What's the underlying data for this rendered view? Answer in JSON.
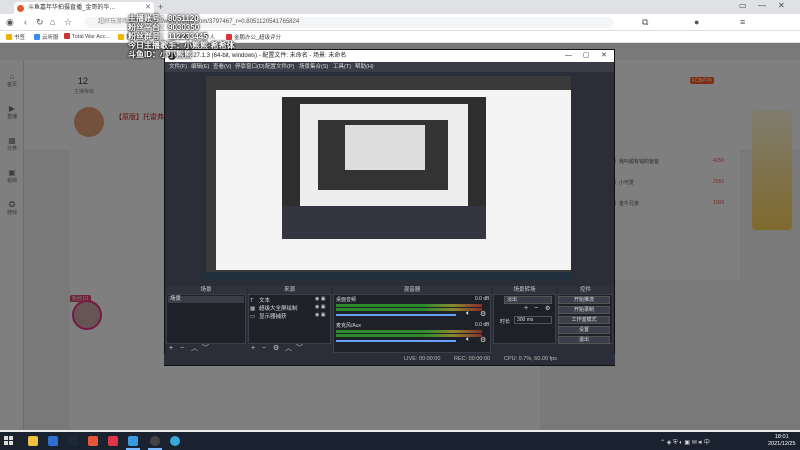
{
  "browser": {
    "tab_title": "斗鱼嘉年华拍摄直播_金哥的华…",
    "address_prefix": "超好玩游戏推荐",
    "address_url": "https://www.douyu.com/3797467_r=0.805112054176582​4",
    "bookmarks": [
      "书签",
      "云听服",
      "Total War Acc…",
      "我的门户",
      "上传...",
      "下载",
      "个人",
      "金鹏办公_超级评分"
    ]
  },
  "overlay": {
    "line1": "主播账号：8051120",
    "line2": "粉丝平台：9030350",
    "line3": "粉丝群号：112233445",
    "line4": "今日主播歌手：小熊熊·希希体",
    "line5": "斗鱼ID：小小熊熊"
  },
  "page": {
    "stream_title": "【原版】托雷弗…",
    "left_nav": [
      {
        "icon": "home-icon",
        "label": "首页"
      },
      {
        "icon": "live-icon",
        "label": "直播"
      },
      {
        "icon": "category-icon",
        "label": "分类"
      },
      {
        "icon": "video-icon",
        "label": "视频"
      },
      {
        "icon": "game-icon",
        "label": "游戏"
      }
    ],
    "stats": {
      "value": "12",
      "label": "主播等级"
    },
    "rank_items": [
      {
        "name": "我叫超有钱的爸爸",
        "score": "4250"
      },
      {
        "name": "小可爱",
        "score": "2050"
      },
      {
        "name": "金牛兄弟",
        "score": "1000"
      }
    ],
    "fcb_label": "FCB户外",
    "gift_tag": "粉丝1/1",
    "gift_count": "0/1"
  },
  "obs": {
    "window_title": "OBS 27.1.3 (64-bit, windows) - 配置文件: 未命名 - 场景: 未命名",
    "menu": [
      "文件(F)",
      "编辑(E)",
      "查看(V)",
      "停靠窗口(D)",
      "配置文件(P)",
      "场景集合(S)",
      "工具(T)",
      "帮助(H)"
    ],
    "docks": {
      "scenes": "场景",
      "sources": "来源",
      "mixer": "混音器",
      "transitions": "场景转场",
      "controls": "控件"
    },
    "scene_items": [
      "场景"
    ],
    "source_items": [
      {
        "icon": "T",
        "label": "文本"
      },
      {
        "icon": "▦",
        "label": "超级大全屏绘制"
      },
      {
        "icon": "▭",
        "label": "显示器捕获"
      }
    ],
    "mixer_channels": [
      {
        "label": "桌面音频",
        "db": "0.0 dB"
      },
      {
        "label": "麦克风/Aux",
        "db": "0.0 dB"
      }
    ],
    "transition": {
      "type": "淡出",
      "duration_label": "时长",
      "duration": "300 ms"
    },
    "controls": [
      "开始推流",
      "开始录制",
      "工作室模式",
      "设置",
      "退出"
    ],
    "status": {
      "live": "LIVE: 00:00:00",
      "rec": "REC: 00:00:00",
      "cpu": "CPU: 0.7%, 60.00 fps"
    }
  },
  "taskbar": {
    "time": "18:01",
    "date": "2021/12/25"
  }
}
